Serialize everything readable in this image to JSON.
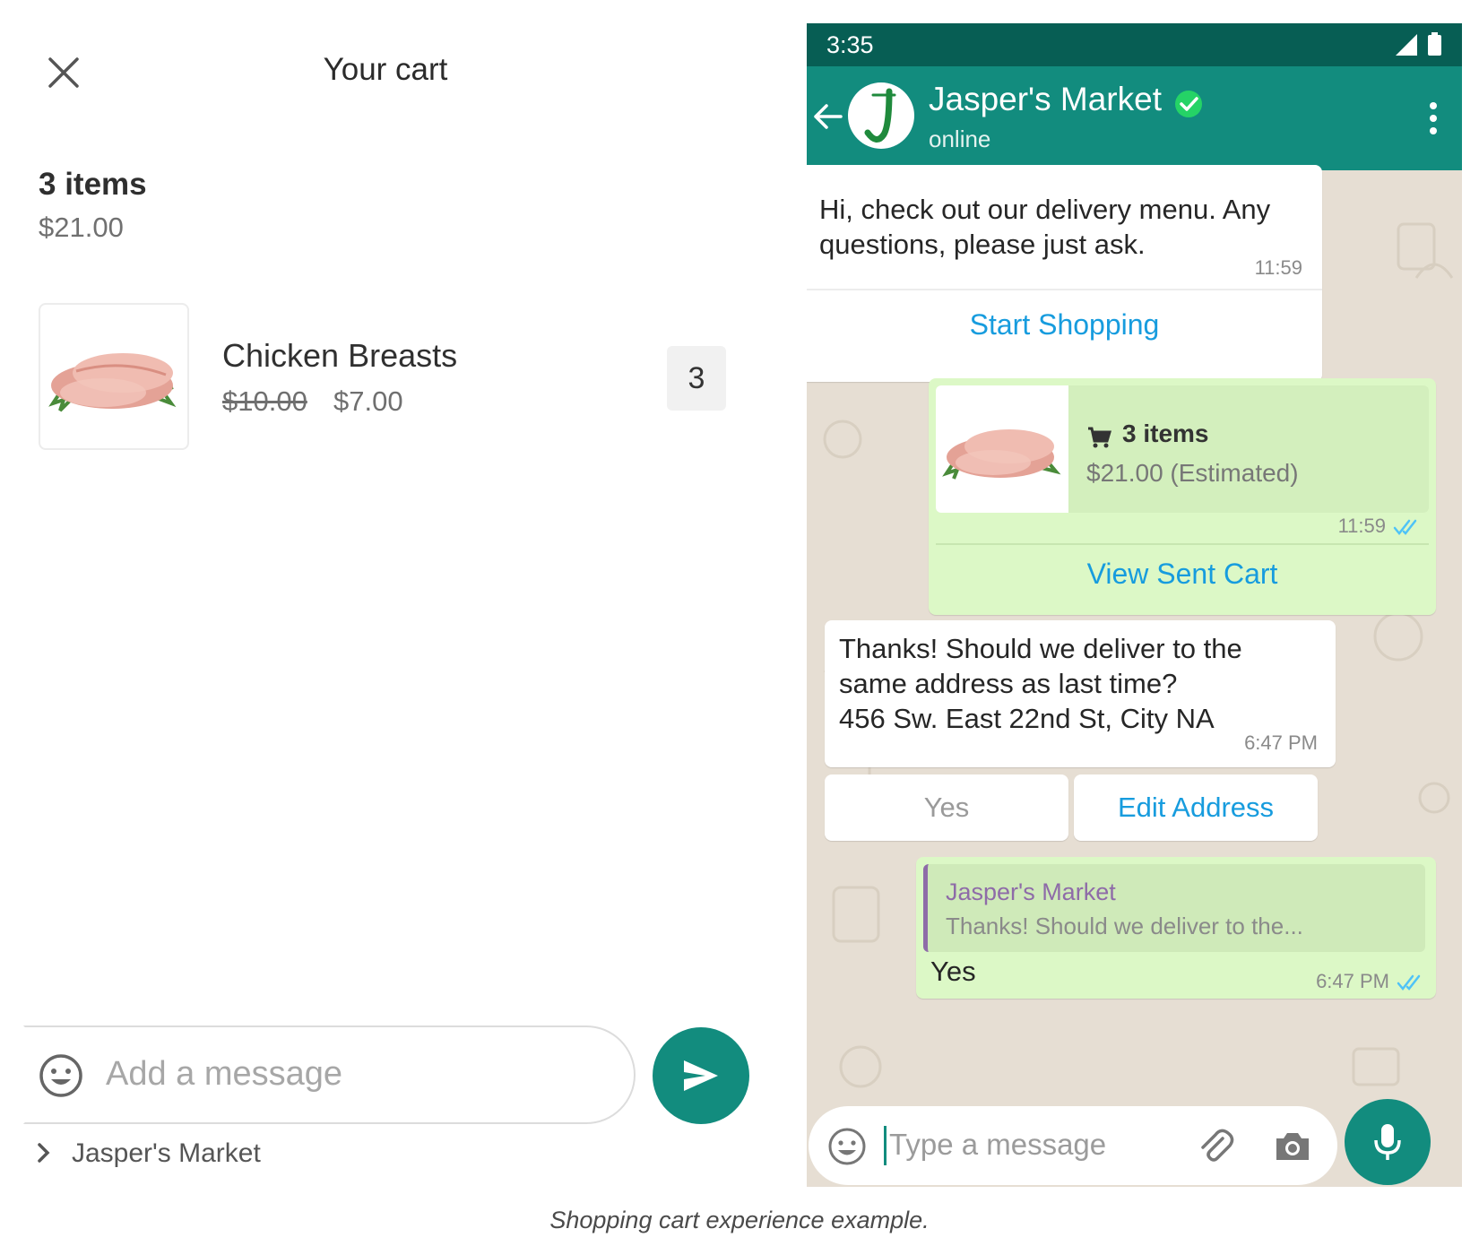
{
  "cart_screen": {
    "title": "Your cart",
    "item_count": "3 items",
    "total": "$21.00",
    "item": {
      "name": "Chicken Breasts",
      "original_price": "$10.00",
      "sale_price": "$7.00",
      "quantity": "3",
      "image_icon": "chicken-breast-image"
    },
    "message_placeholder": "Add a message",
    "recipient": "Jasper's Market",
    "icons": {
      "close": "close-icon",
      "emoji": "smiley-icon",
      "send": "send-icon",
      "chevron": "chevron-right-icon"
    },
    "colors": {
      "accent": "#128c7e"
    }
  },
  "chat_screen": {
    "status_bar": {
      "time": "3:35"
    },
    "header": {
      "name": "Jasper's Market",
      "status": "online",
      "avatar_letter": "J"
    },
    "messages": [
      {
        "text": "Hi, check out our delivery menu. Any questions, please just ask.",
        "time": "11:59",
        "button": "Start Shopping"
      },
      {
        "cart_items": "3 items",
        "cart_price": "$21.00 (Estimated)",
        "time": "11:59",
        "button": "View Sent Cart"
      },
      {
        "text": "Thanks! Should we deliver to the same address as last time? 456 Sw. East 22nd St, City NA",
        "line1": "Thanks! Should we deliver to the",
        "line2": "same address as last time?",
        "line3": "456 Sw. East 22nd St, City NA",
        "time": "6:47 PM",
        "reply_yes": "Yes",
        "reply_edit": "Edit Address"
      },
      {
        "quote_name": "Jasper's Market",
        "quote_text": "Thanks! Should we deliver to the...",
        "text": "Yes",
        "time": "6:47 PM"
      }
    ],
    "input_placeholder": "Type a message",
    "colors": {
      "header": "#128c7e",
      "status_bar": "#075e54",
      "outgoing_bubble": "#dcf8c6",
      "link": "#179cde",
      "background": "#e6ded3"
    }
  },
  "caption": "Shopping cart experience example."
}
